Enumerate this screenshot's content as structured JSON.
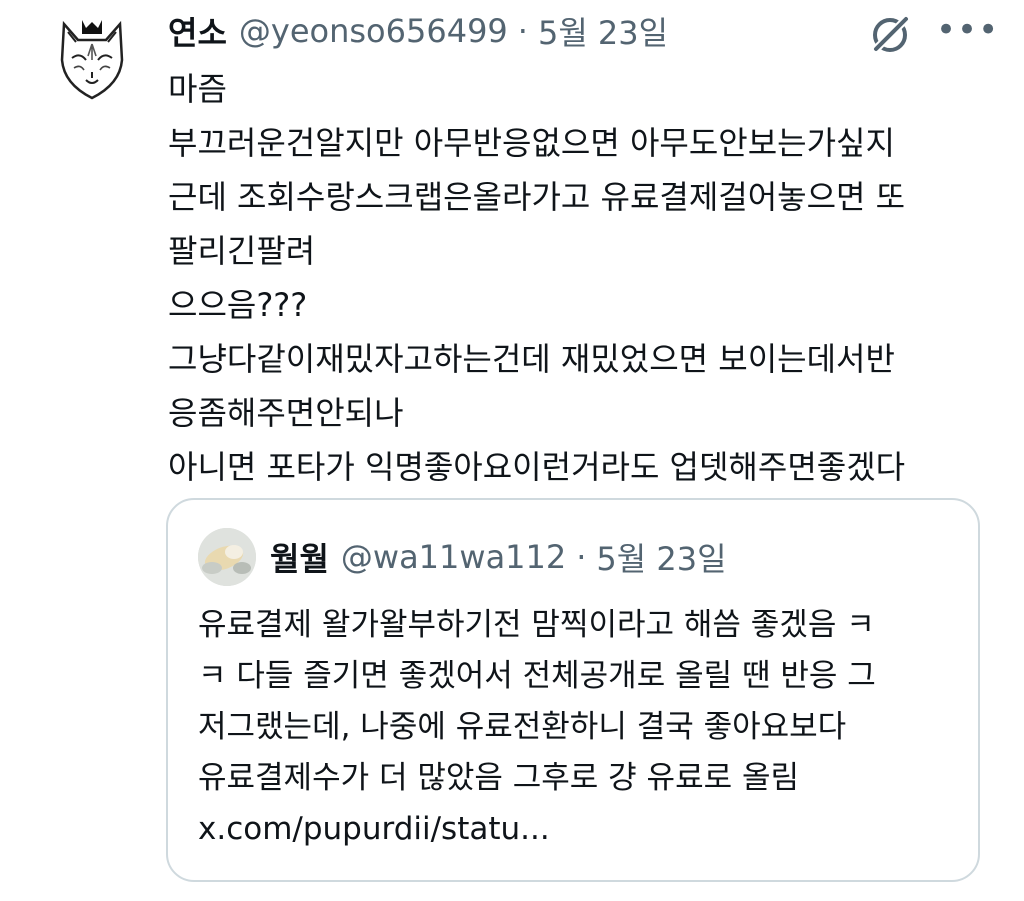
{
  "tweet": {
    "author_name": "연소",
    "author_handle": "@yeonso656499",
    "separator": "·",
    "date": "5월 23일",
    "icons": {
      "avatar": "fox-mask-icon",
      "grok": "grok-icon",
      "more": "more-icon"
    },
    "more_label": "•••",
    "lines": [
      "마즘",
      "부끄러운건알지만 아무반응없으면 아무도안보는가싶지",
      "근데 조회수랑스크랩은올라가고 유료결제걸어놓으면 또",
      "팔리긴팔려",
      "으으음???",
      "그냥다같이재밌자고하는건데 재밌었으면 보이는데서반",
      "응좀해주면안되나",
      "아니면 포타가 익명좋아요이런거라도 업뎃해주면좋겠다"
    ]
  },
  "quote": {
    "author_name": "월월",
    "author_handle": "@wa11wa112",
    "separator": "·",
    "date": "5월 23일",
    "lines": [
      "유료결제 왈가왈부하기전 맘찍이라고 해씀 좋겠음 ㅋ",
      "ㅋ 다들 즐기면 좋겠어서 전체공개로 올릴 땐 반응 그",
      "저그랬는데, 나중에 유료전환하니 결국 좋아요보다",
      "유료결제수가 더 많았음 그후로 걍 유료로 올림",
      "x.com/pupurdii/statu..."
    ]
  },
  "colors": {
    "text": "#0f1419",
    "secondary": "#536471",
    "border": "#cfd9de",
    "background": "#ffffff"
  }
}
